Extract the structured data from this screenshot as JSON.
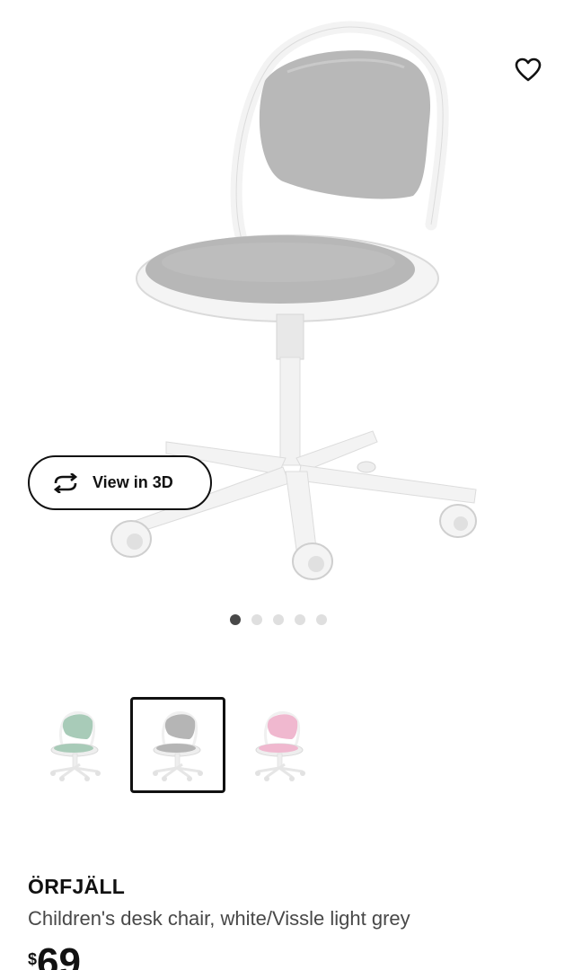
{
  "product": {
    "name": "ÖRFJÄLL",
    "description": "Children's desk chair, white/Vissle light grey",
    "price": {
      "currency": "$",
      "value": "69"
    }
  },
  "gallery": {
    "view3d_label": "View in 3D",
    "dots_total": 5,
    "active_dot": 1,
    "fav_icon": "heart-outline-icon",
    "view3d_icon": "rotate-arrows-icon"
  },
  "variants": [
    {
      "color_name": "light green",
      "seat_color": "#a8cbb8",
      "selected": false
    },
    {
      "color_name": "light grey",
      "seat_color": "#b5b5b5",
      "selected": true
    },
    {
      "color_name": "pink",
      "seat_color": "#f0b8cf",
      "selected": false
    }
  ],
  "colors": {
    "text_primary": "#111111",
    "text_secondary": "#484848",
    "chair_seat": "#b7b7b7",
    "chair_frame": "#f4f4f4"
  }
}
